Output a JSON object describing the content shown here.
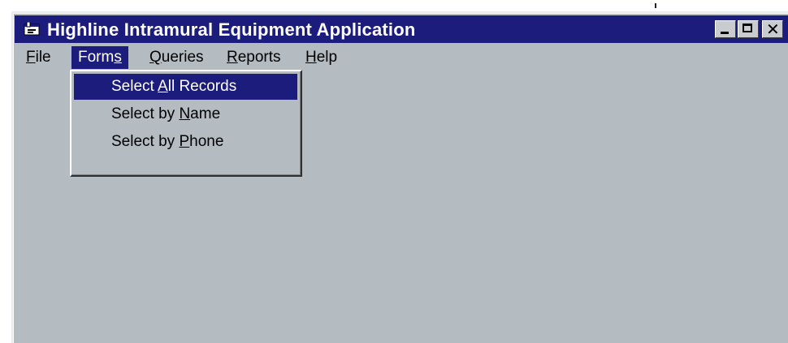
{
  "window": {
    "title": "Highline Intramural Equipment Application",
    "buttons": {
      "minimize": "minimize-icon",
      "maximize": "maximize-icon",
      "close": "close-icon"
    }
  },
  "menubar": {
    "items": [
      {
        "pre": "",
        "ul": "F",
        "post": "ile"
      },
      {
        "pre": "Form",
        "ul": "s",
        "post": ""
      },
      {
        "pre": "",
        "ul": "Q",
        "post": "ueries"
      },
      {
        "pre": "",
        "ul": "R",
        "post": "eports"
      },
      {
        "pre": "",
        "ul": "H",
        "post": "elp"
      }
    ],
    "active_index": 1
  },
  "dropdown": {
    "items": [
      {
        "pre": "Select ",
        "ul": "A",
        "post": "ll Records"
      },
      {
        "pre": "Select by ",
        "ul": "N",
        "post": "ame"
      },
      {
        "pre": "Select by ",
        "ul": "P",
        "post": "hone"
      }
    ],
    "selected_index": 0
  },
  "colors": {
    "titlebar": "#1c1c7c",
    "window_bg": "#b4bbc1",
    "highlight": "#1c1c7c",
    "highlight_text": "#ffffff"
  }
}
